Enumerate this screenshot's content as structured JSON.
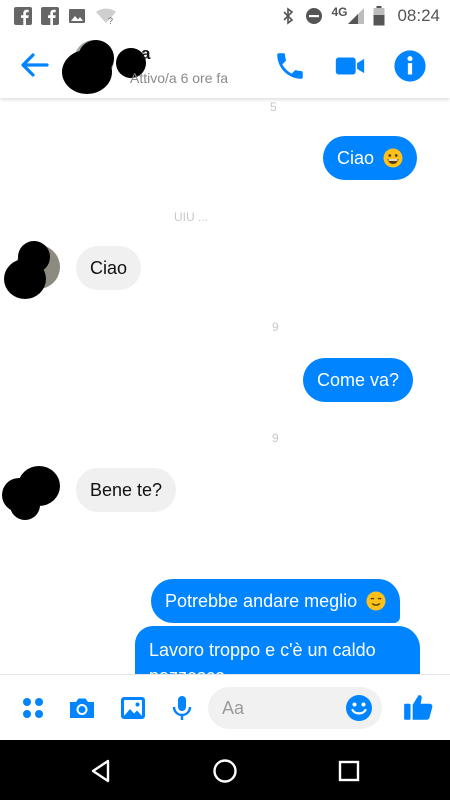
{
  "status_bar": {
    "left_icons": [
      "facebook-icon",
      "facebook-icon",
      "image-icon",
      "wifi-unknown-icon"
    ],
    "right_icons": [
      "bluetooth-icon",
      "do-not-disturb-icon",
      "signal-icon",
      "battery-icon"
    ],
    "network": "4G",
    "time": "08:24"
  },
  "header": {
    "contact_name_visible": "a",
    "contact_status": "Attivo/a 6 ore fa"
  },
  "messages": [
    {
      "direction": "out",
      "text": "Ciao",
      "emoji": "grinning-emoji"
    },
    {
      "direction": "in",
      "text": "Ciao"
    },
    {
      "direction": "out",
      "text": "Come va?"
    },
    {
      "direction": "in",
      "text": "Bene te?"
    },
    {
      "direction": "out",
      "text": "Potrebbe andare meglio",
      "emoji": "relieved-emoji"
    },
    {
      "direction": "out",
      "text": "Lavoro troppo e c'è un caldo"
    },
    {
      "direction": "out",
      "text": "pazzesco"
    }
  ],
  "composer": {
    "placeholder": "Aa"
  },
  "colors": {
    "accent": "#0084ff",
    "incoming_bubble": "#f0f0f0",
    "nav_bar": "#000000"
  }
}
